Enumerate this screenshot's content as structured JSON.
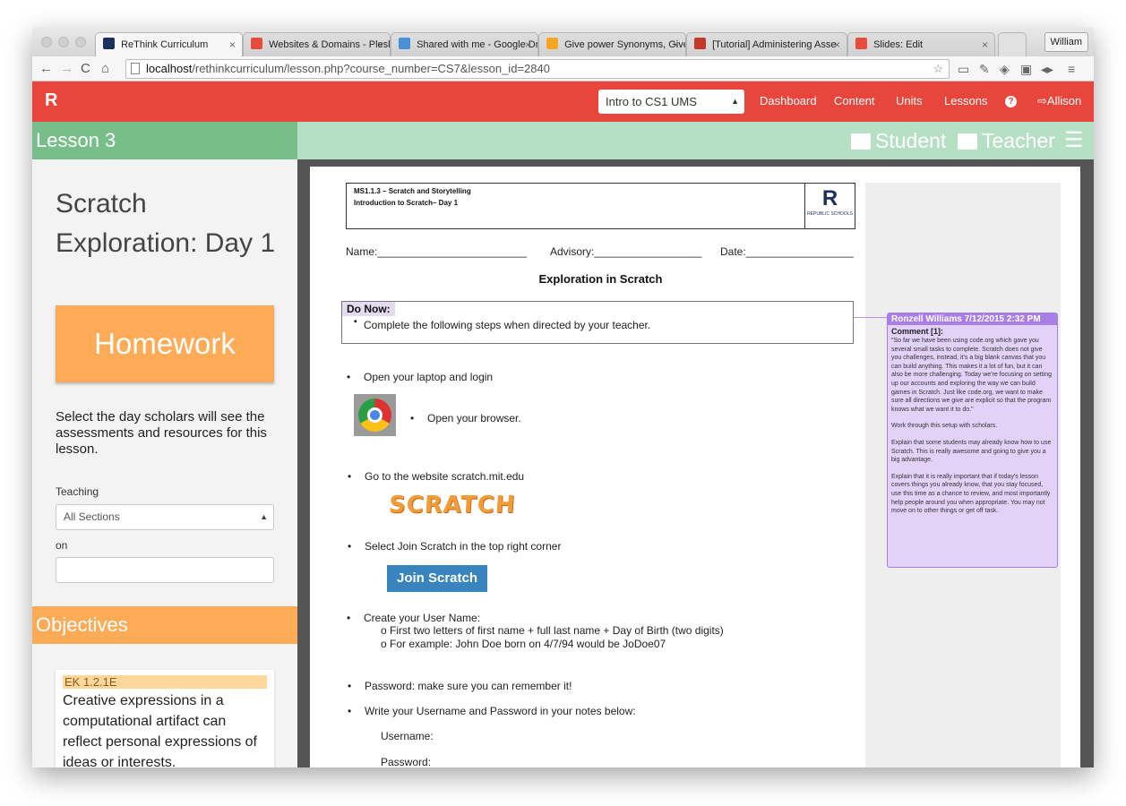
{
  "browser": {
    "tabs": [
      {
        "label": "ReThink Curriculum",
        "favicon_color": "#1d2f5c"
      },
      {
        "label": "Websites & Domains - Plesk",
        "favicon_color": "#e84b3c"
      },
      {
        "label": "Shared with me - Google Dr",
        "favicon_color": "#4a90d9"
      },
      {
        "label": "Give power Synonyms, Give",
        "favicon_color": "#f5a623"
      },
      {
        "label": "[Tutorial] Administering Asse",
        "favicon_color": "#c0392b"
      },
      {
        "label": "Slides: Edit",
        "favicon_color": "#e74c3c"
      }
    ],
    "user": "William",
    "url_host": "localhost",
    "url_path": "/rethinkcurriculum/lesson.php?course_number=CS7&lesson_id=2840"
  },
  "nav": {
    "brand": "R",
    "course_selected": "Intro to CS1 UMS",
    "links": [
      "Dashboard",
      "Content",
      "Units",
      "Lessons"
    ],
    "help": "?",
    "user": "Allison",
    "accent": "#e8453c"
  },
  "header": {
    "lesson_label": "Lesson 3",
    "student_label": "Student",
    "teacher_label": "Teacher"
  },
  "sidebar": {
    "title": "Scratch Exploration: Day 1",
    "homework_label": "Homework",
    "description": "Select the day scholars will see the assessments and resources for this lesson.",
    "teaching_label": "Teaching",
    "teaching_selected": "All Sections",
    "on_label": "on",
    "date_value": "",
    "objectives_label": "Objectives",
    "objective_code": "EK 1.2.1E",
    "objective_text": "Creative expressions in a computational artifact can reflect personal expressions of ideas or interests."
  },
  "document": {
    "header_line1": "MS1.1.3  – Scratch and Storytelling",
    "header_line2": "Introduction to Scratch– Day 1",
    "logo_letter": "R",
    "logo_text": "REPUBLIC SCHOOLS",
    "name_line": "Name:_________________________",
    "advisory_line": "Advisory:__________________",
    "date_line": "Date:__________________",
    "title": "Exploration in Scratch",
    "do_now_label": "Do Now:",
    "do_now_text": "Complete the following steps when directed by your teacher.",
    "steps": {
      "login": "Open your laptop and login",
      "browser": "Open your browser.",
      "website": "Go to the website scratch.mit.edu",
      "scratch_logo": "SCRATCH",
      "join": "Select Join Scratch in the top right corner",
      "join_button": "Join Scratch",
      "username": "Create your User Name:",
      "username_sub1": "o First two letters of first name + full last name + Day of Birth (two digits)",
      "username_sub2": "o For example: John Doe born on 4/7/94 would be JoDoe07",
      "password": "Password: make sure you can remember it!",
      "write": "Write your Username and Password in your notes below:",
      "username_field": "Username:",
      "password_field": "Password:"
    },
    "comment": {
      "author": "Ronzell Williams 7/12/2015 2:32 PM",
      "label": "Comment [1]:",
      "p1": "\"So far we have been using code.org which gave you several small tasks to complete. Scratch does not give you challenges, instead, it's a big blank canvas that you can build anything. This makes it a lot of fun, but it can also be more challenging. Today we're focusing on setting up our accounts and exploring the way we can build games in Scratch. Just like code.org, we want to make sure all directions we give are explicit so that the program knows what we want it to do.\"",
      "p2": "Work through this setup with scholars.",
      "p3": "Explain that some students may already know how to use Scratch. This is really awesome and going to give you a big advantage.",
      "p4": "Explain that it is really important that if today's lesson covers things you already know, that you stay focused, use this time as a chance to review, and most importantly help people around you when appropriate. You may not move on to other things or get off task."
    }
  }
}
